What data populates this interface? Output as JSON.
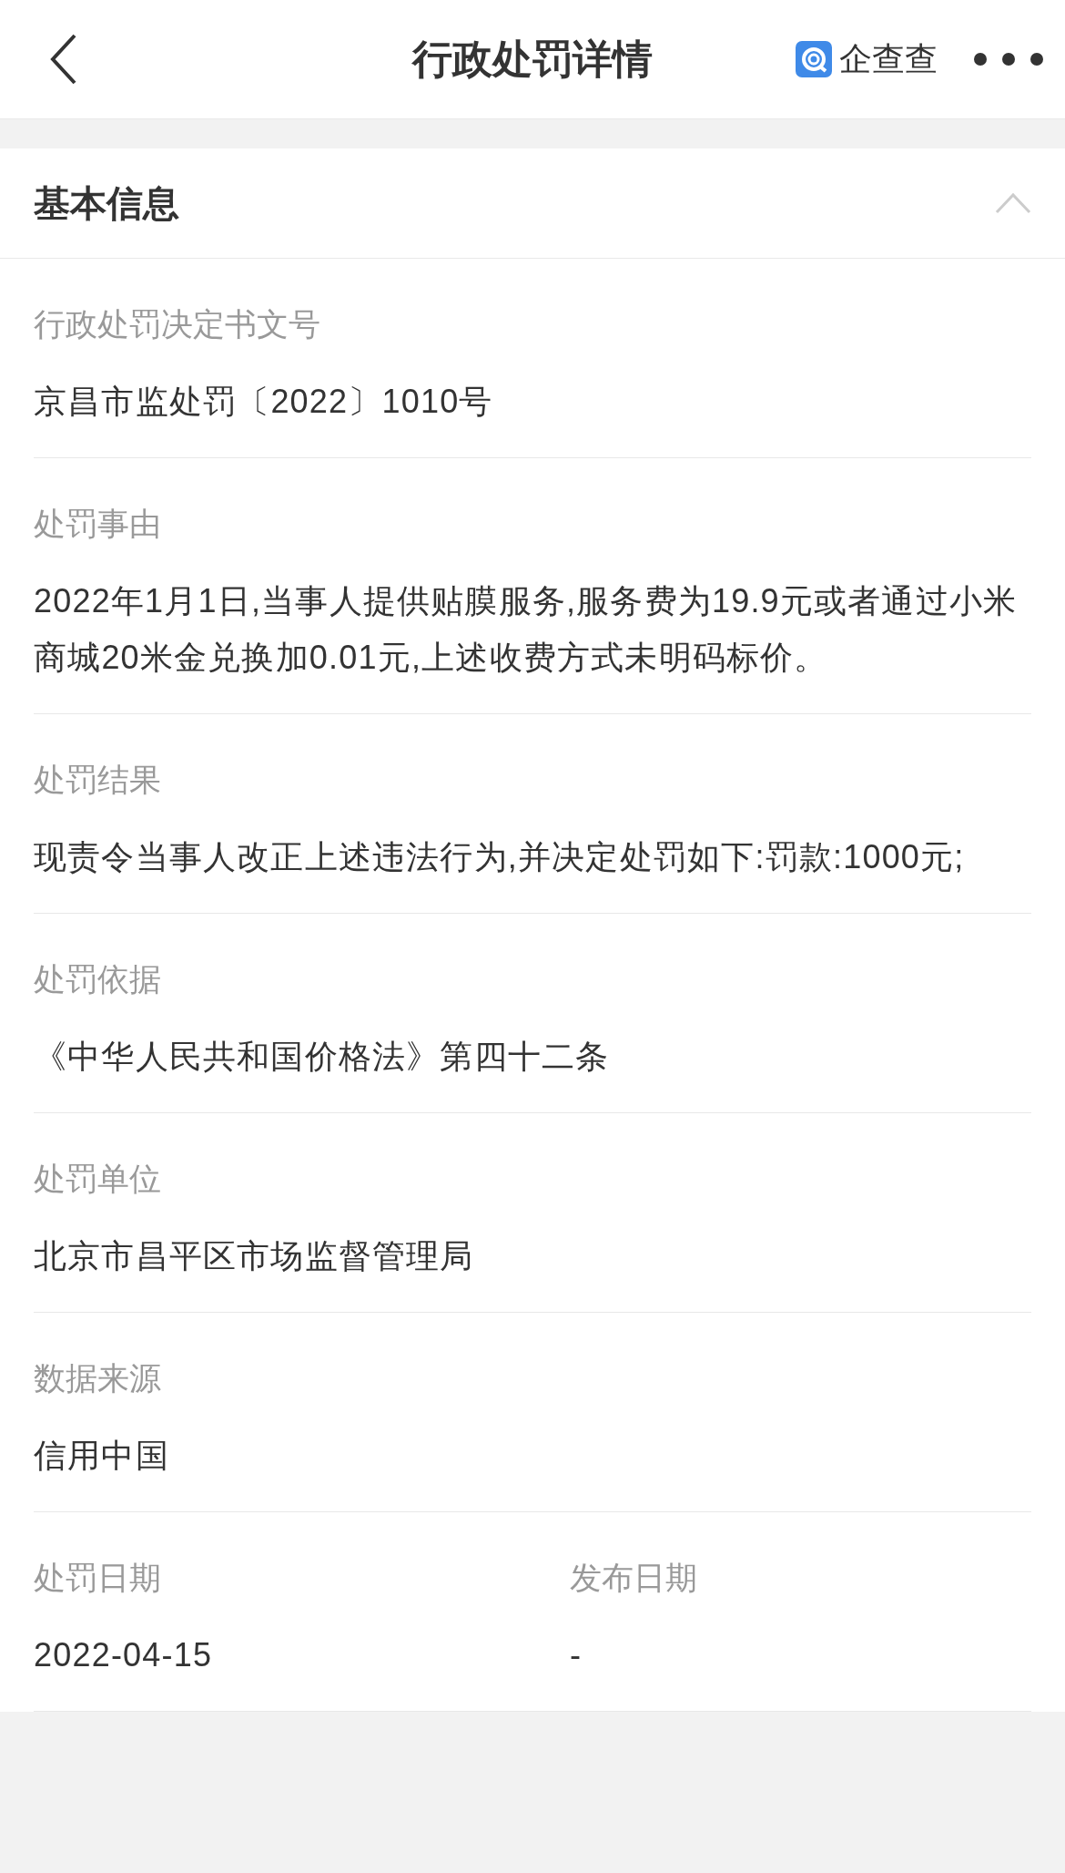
{
  "nav": {
    "title": "行政处罚详情",
    "brand": "企查查"
  },
  "section": {
    "title": "基本信息",
    "expanded": true
  },
  "fields": [
    {
      "label": "行政处罚决定书文号",
      "value": "京昌市监处罚〔2022〕1010号"
    },
    {
      "label": "处罚事由",
      "value": "2022年1月1日,当事人提供贴膜服务,服务费为19.9元或者通过小米商城20米金兑换加0.01元,上述收费方式未明码标价。"
    },
    {
      "label": "处罚结果",
      "value": "现责令当事人改正上述违法行为,并决定处罚如下:罚款:1000元;"
    },
    {
      "label": "处罚依据",
      "value": "《中华人民共和国价格法》第四十二条"
    },
    {
      "label": "处罚单位",
      "value": "北京市昌平区市场监督管理局"
    },
    {
      "label": "数据来源",
      "value": "信用中国"
    }
  ],
  "dates": [
    {
      "label": "处罚日期",
      "value": "2022-04-15"
    },
    {
      "label": "发布日期",
      "value": "-"
    }
  ]
}
